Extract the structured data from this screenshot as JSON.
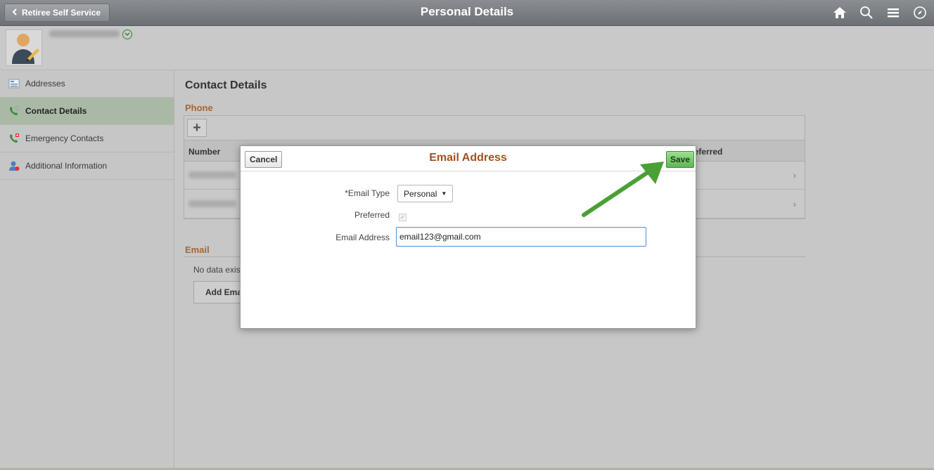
{
  "header": {
    "back_label": "Retiree Self Service",
    "title": "Personal Details",
    "icons": [
      "home-icon",
      "search-icon",
      "menu-icon",
      "navbar-compass-icon"
    ]
  },
  "sidebar": {
    "items": [
      {
        "label": "Addresses",
        "icon": "address-icon",
        "active": false
      },
      {
        "label": "Contact Details",
        "icon": "phone-icon",
        "active": true
      },
      {
        "label": "Emergency Contacts",
        "icon": "emergency-phone-icon",
        "active": false
      },
      {
        "label": "Additional Information",
        "icon": "person-info-icon",
        "active": false
      }
    ]
  },
  "main": {
    "title": "Contact Details",
    "phone": {
      "label": "Phone",
      "columns": {
        "number": "Number",
        "preferred": "Preferred"
      }
    },
    "email": {
      "label": "Email",
      "no_data": "No data exists.",
      "add_button": "Add Email Address"
    }
  },
  "modal": {
    "title": "Email Address",
    "cancel_label": "Cancel",
    "save_label": "Save",
    "email_type_label": "*Email Type",
    "email_type_value": "Personal",
    "preferred_label": "Preferred",
    "preferred_checked": true,
    "email_address_label": "Email Address",
    "email_address_value": "email123@gmail.com"
  },
  "colors": {
    "accent_orange": "#a0531f",
    "save_green": "#5cb653",
    "arrow_green": "#4aa034",
    "sidebar_active": "#a9b9a5"
  }
}
